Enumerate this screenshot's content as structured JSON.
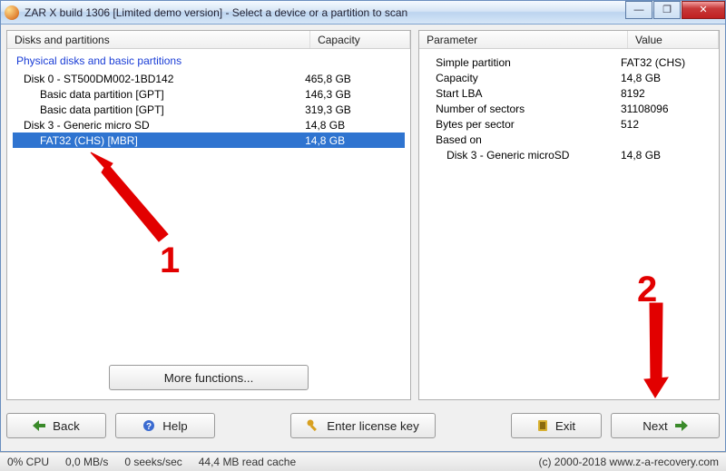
{
  "window": {
    "title": "ZAR X build 1306 [Limited demo version] - Select a device or a partition to scan"
  },
  "win_controls": {
    "min": "—",
    "max": "❐",
    "close": "✕"
  },
  "left": {
    "col_disks": "Disks and partitions",
    "col_capacity": "Capacity",
    "section": "Physical disks and basic partitions",
    "rows": [
      {
        "name": "Disk 0 - ST500DM002-1BD142",
        "cap": "465,8 GB",
        "indent": 1,
        "selected": false
      },
      {
        "name": "Basic data partition [GPT]",
        "cap": "146,3 GB",
        "indent": 2,
        "selected": false
      },
      {
        "name": "Basic data partition [GPT]",
        "cap": "319,3 GB",
        "indent": 2,
        "selected": false
      },
      {
        "name": "Disk 3 - Generic micro SD",
        "cap": "14,8 GB",
        "indent": 1,
        "selected": false
      },
      {
        "name": "FAT32 (CHS) [MBR]",
        "cap": "14,8 GB",
        "indent": 2,
        "selected": true
      }
    ],
    "more_functions": "More functions..."
  },
  "right": {
    "col_param": "Parameter",
    "col_value": "Value",
    "rows": [
      {
        "p": "Simple partition",
        "v": "FAT32 (CHS)"
      },
      {
        "p": "Capacity",
        "v": "14,8 GB"
      },
      {
        "p": "Start LBA",
        "v": "8192"
      },
      {
        "p": "Number of sectors",
        "v": "31108096"
      },
      {
        "p": "Bytes per sector",
        "v": "512"
      },
      {
        "p": "Based on",
        "v": ""
      },
      {
        "p": "Disk 3 - Generic microSD",
        "v": "14,8 GB",
        "sub": true
      }
    ]
  },
  "buttons": {
    "back": "Back",
    "help": "Help",
    "license": "Enter license key",
    "exit": "Exit",
    "next": "Next"
  },
  "status": {
    "cpu": "0% CPU",
    "mbs": "0,0 MB/s",
    "seeks": "0 seeks/sec",
    "cache": "44,4 MB read cache",
    "copyright": "(c) 2000-2018 www.z-a-recovery.com"
  },
  "annotations": {
    "label1": "1",
    "label2": "2"
  }
}
